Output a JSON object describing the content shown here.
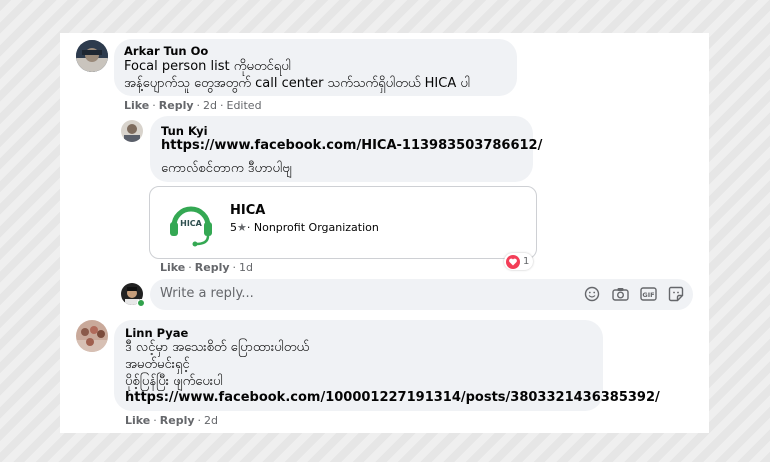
{
  "comments": [
    {
      "author": "Arkar Tun Oo",
      "lines": [
        "Focal person list ကိုမတင်ရပါ",
        "အန့်ပျောက်သူ တွေအတွက် call center သက်သက်ရှိပါတယ် HICA ပါ"
      ],
      "actions": {
        "like": "Like",
        "reply": "Reply",
        "time": "2d",
        "edited": "Edited"
      }
    },
    {
      "author": "Tun Kyi",
      "link": "https://www.facebook.com/HICA-113983503786612/",
      "lines": [
        "ကောလ်စင်တာက ဒီဟာပါဗျ"
      ],
      "card": {
        "logo_text": "HICA",
        "title": "HICA",
        "rating": "5",
        "category": "· Nonprofit Organization"
      },
      "reactions": {
        "count": "1"
      },
      "actions": {
        "like": "Like",
        "reply": "Reply",
        "time": "1d"
      }
    },
    {
      "author": "Linn Pyae",
      "lines": [
        "ဒီ လင့်မှာ အသေးစိတ် ပြောထားပါတယ်",
        "အမတ်မင်းရှင့်",
        "ပိုစ့်ပြန်ပြီး ဖျက်ပေးပါ"
      ],
      "link": "https://www.facebook.com/100001227191314/posts/3803321436385392/",
      "actions": {
        "like": "Like",
        "reply": "Reply",
        "time": "2d"
      }
    }
  ],
  "reply_box": {
    "placeholder": "Write a reply...",
    "icons": [
      "emoji-icon",
      "camera-icon",
      "gif-icon",
      "sticker-icon"
    ]
  },
  "colors": {
    "bubble": "#f0f2f5",
    "text": "#050505",
    "meta": "#65676b",
    "hica_green": "#34a853",
    "love_red": "#f33e58",
    "online_green": "#31a24c"
  }
}
